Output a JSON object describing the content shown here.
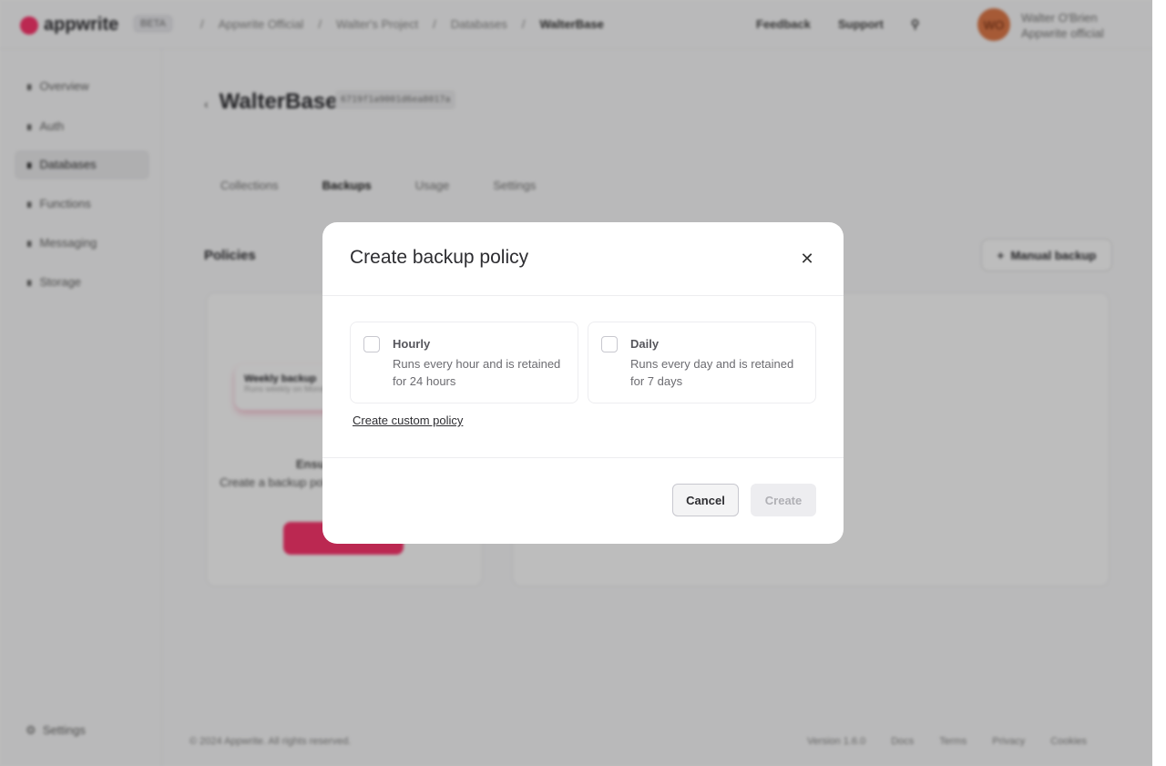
{
  "header": {
    "logo": "appwrite",
    "beta": "BETA",
    "breadcrumbs": [
      "Appwrite Official",
      "Walter's Project",
      "Databases",
      "WalterBase"
    ],
    "links": [
      "Feedback",
      "Support"
    ],
    "avatar_initials": "WO",
    "user_name": "Walter O'Brien",
    "user_org": "Appwrite official"
  },
  "sidebar": {
    "items": [
      {
        "label": "Overview"
      },
      {
        "label": "Auth"
      },
      {
        "label": "Databases",
        "active": true
      },
      {
        "label": "Functions"
      },
      {
        "label": "Messaging"
      },
      {
        "label": "Storage"
      }
    ],
    "settings": "Settings"
  },
  "page": {
    "title": "WalterBase",
    "db_id": "6719f1a9001d6ea8017a",
    "tabs": [
      "Collections",
      "Backups",
      "Usage",
      "Settings"
    ],
    "active_tab": "Backups",
    "policies_label": "Policies",
    "manual_backup": "Manual backup",
    "weekly_backup": "Weekly backup",
    "weekly_desc": "Runs weekly on Mondays",
    "empty_title": "Ensure your data",
    "empty_desc": "Create a backup policy for regular and secure..."
  },
  "footer": {
    "copyright": "© 2024 Appwrite. All rights reserved.",
    "version": "Version 1.6.0",
    "links": [
      "Docs",
      "Terms",
      "Privacy",
      "Cookies"
    ]
  },
  "modal": {
    "title": "Create backup policy",
    "options": [
      {
        "name": "Hourly",
        "description": "Runs every hour and is retained for 24 hours",
        "checked": false
      },
      {
        "name": "Daily",
        "description": "Runs every day and is retained for 7 days",
        "checked": false
      }
    ],
    "custom_link": "Create custom policy",
    "cancel": "Cancel",
    "create": "Create"
  },
  "colors": {
    "brand": "#fd366e",
    "overlay": "rgba(0,0,0,0.26)"
  }
}
